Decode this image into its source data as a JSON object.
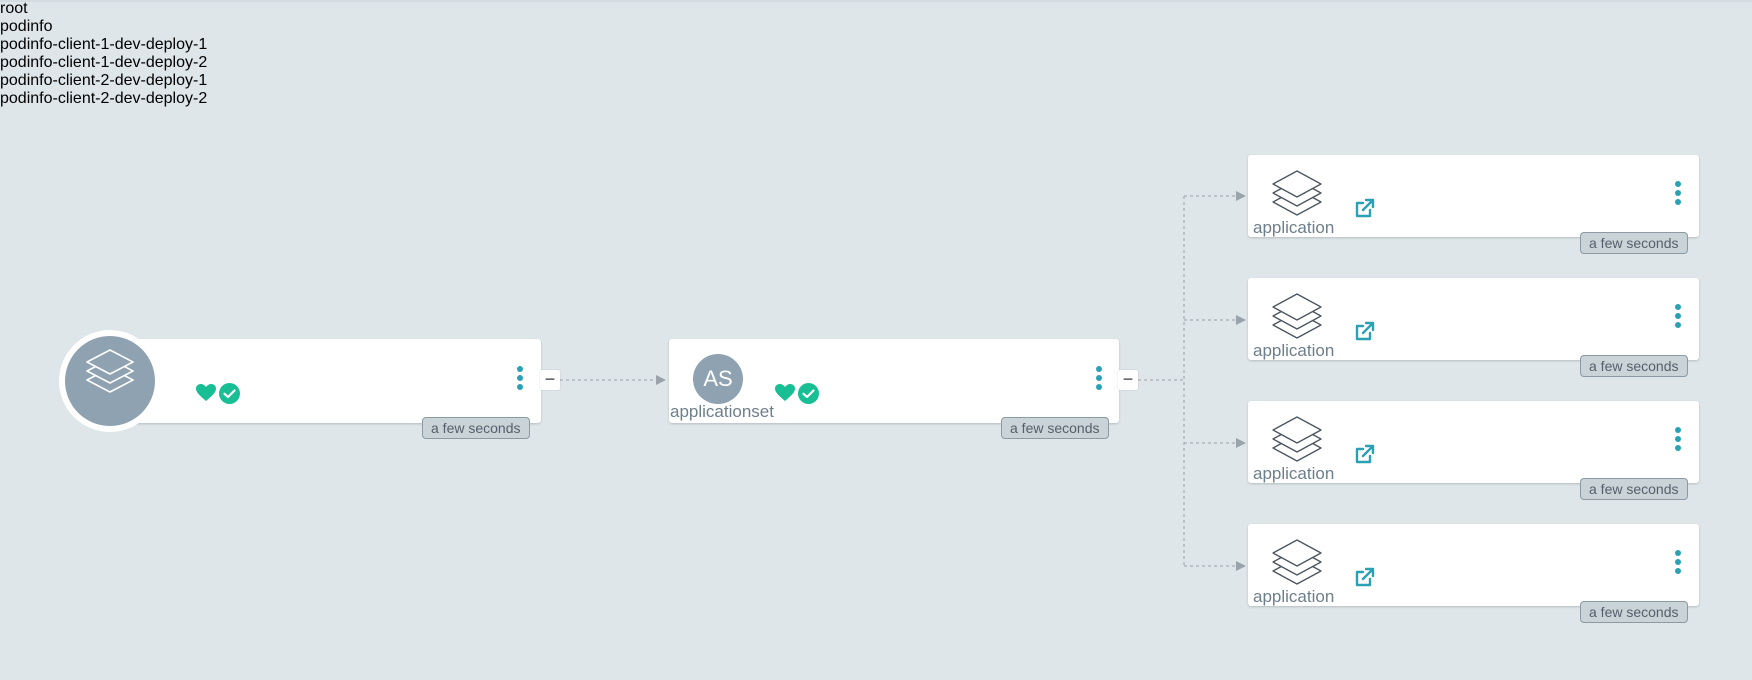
{
  "colors": {
    "background": "#dee6e9",
    "accent": "#2aa1b4",
    "healthy": "#18be94",
    "icon_gray": "#8fa2b1"
  },
  "root": {
    "name": "root",
    "age": "a few seconds",
    "health_icon": "heart-icon",
    "sync_icon": "check-circle-icon",
    "collapse_label": "−"
  },
  "appset": {
    "avatar": "AS",
    "name": "podinfo",
    "kind": "applicationset",
    "age": "a few seconds",
    "collapse_label": "−"
  },
  "apps": [
    {
      "name": "podinfo-client-1-dev-deploy-1",
      "kind": "application",
      "age": "a few seconds"
    },
    {
      "name": "podinfo-client-1-dev-deploy-2",
      "kind": "application",
      "age": "a few seconds"
    },
    {
      "name": "podinfo-client-2-dev-deploy-1",
      "kind": "application",
      "age": "a few seconds"
    },
    {
      "name": "podinfo-client-2-dev-deploy-2",
      "kind": "application",
      "age": "a few seconds"
    }
  ]
}
